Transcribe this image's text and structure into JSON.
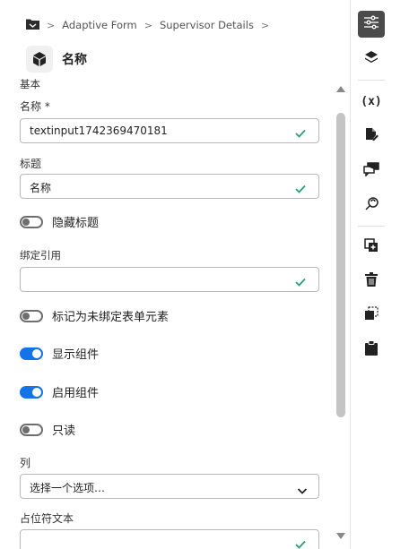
{
  "breadcrumb": {
    "items": [
      "Adaptive Form",
      "Supervisor Details"
    ]
  },
  "component": {
    "title": "名称"
  },
  "form": {
    "section_heading": "基本",
    "name_label": "名称 *",
    "name_value": "textinput1742369470181",
    "title_label": "标题",
    "title_value": "名称",
    "hide_title_label": "隐藏标题",
    "binding_label": "绑定引用",
    "binding_value": "",
    "unbound_label": "标记为未绑定表单元素",
    "show_component_label": "显示组件",
    "enable_component_label": "启用组件",
    "readonly_label": "只读",
    "column_label": "列",
    "column_value": "选择一个选项…",
    "placeholder_label": "占位符文本"
  },
  "toggles": {
    "hide_title": false,
    "unbound": false,
    "show_component": true,
    "enable_component": true,
    "readonly": false
  },
  "colors": {
    "accent": "#1473e6",
    "valid_check": "#2d9d78",
    "active_tool_bg": "#4b4b4b"
  },
  "tools": {
    "variable_symbol": "(x)"
  }
}
